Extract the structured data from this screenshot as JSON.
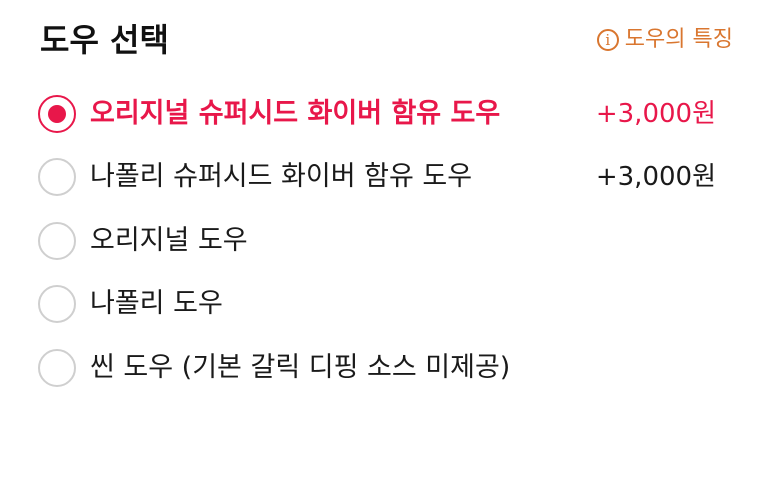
{
  "header": {
    "title": "도우 선택",
    "info_label": "도우의 특징",
    "info_icon": "info-icon"
  },
  "colors": {
    "accent": "#e8174a",
    "info": "#d9762f",
    "radio_border": "#cfcfcf",
    "text": "#1a1a1a"
  },
  "options": [
    {
      "label": "오리지널 슈퍼시드 화이버 함유 도우",
      "price": "+3,000원",
      "selected": true
    },
    {
      "label": "나폴리 슈퍼시드 화이버 함유 도우",
      "price": "+3,000원",
      "selected": false
    },
    {
      "label": "오리지널 도우",
      "price": "",
      "selected": false
    },
    {
      "label": "나폴리 도우",
      "price": "",
      "selected": false
    },
    {
      "label": "씬 도우 (기본 갈릭 디핑 소스 미제공)",
      "price": "",
      "selected": false
    }
  ]
}
